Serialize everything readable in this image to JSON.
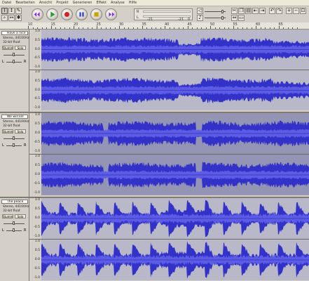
{
  "menu": {
    "items": [
      "Datei",
      "Bearbeiten",
      "Ansicht",
      "Projekt",
      "Generieren",
      "Effekt",
      "Analyse",
      "Hilfe"
    ]
  },
  "toolbar": {
    "meter_right_label": "R",
    "meter_left_label": "L",
    "meter_scale_a": "-21",
    "meter_scale_b": "-21",
    "meter_scale_c": "0"
  },
  "ruler": {
    "ticks": [
      "10",
      "15",
      "20",
      "25",
      "30",
      "35",
      "40",
      "45",
      "50",
      "55",
      "60",
      "65"
    ]
  },
  "scale_labels": [
    "1.0",
    "0.5",
    "0.0",
    "-0.5",
    "-1.0"
  ],
  "tracks": [
    {
      "title": "Have a nice",
      "info_line1": "Stereo, 44100Hz",
      "info_line2": "32-bit float",
      "mute": "Stumm",
      "solo": "Solo",
      "left": "L",
      "right": "R",
      "wave_color": "#3232c8",
      "bg_color": "#b8b8c8",
      "seed": 3,
      "style": "dense"
    },
    {
      "title": "We will kill",
      "info_line1": "Stereo, 44100Hz",
      "info_line2": "32-bit float",
      "mute": "Stumm",
      "solo": "Solo",
      "left": "L",
      "right": "R",
      "wave_color": "#3232c8",
      "bg_color": "#9494b4",
      "seed": 11,
      "style": "dense"
    },
    {
      "title": "The peace",
      "info_line1": "Stereo, 44100Hz",
      "info_line2": "32-bit float",
      "mute": "Stumm",
      "solo": "Solo",
      "left": "L",
      "right": "R",
      "wave_color": "#3232c8",
      "bg_color": "#b8b8c8",
      "seed": 23,
      "style": "pulse"
    }
  ]
}
